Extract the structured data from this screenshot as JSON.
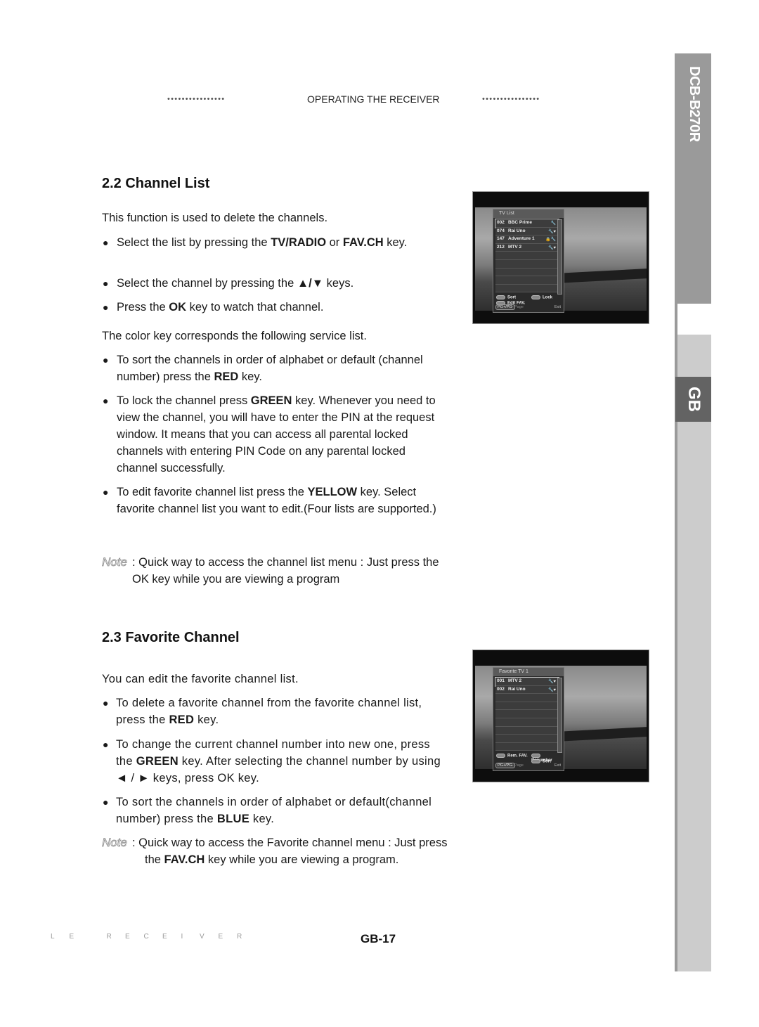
{
  "header": {
    "dots_left": "••••••••••••••••",
    "title": "OPERATING THE RECEIVER",
    "dots_right": "••••••••••••••••"
  },
  "side_tab": {
    "model": "DCB-B270R",
    "language": "GB"
  },
  "section_channel_list": {
    "heading": "2.2 Channel List",
    "intro": "This function is used to delete the channels.",
    "bullets": [
      {
        "pre": "Select the list by pressing the ",
        "b1": "TV/RADIO",
        "mid": " or ",
        "b2": "FAV.CH",
        "post": " key."
      },
      {
        "pre": "Select the channel by pressing the ",
        "arrows": "▲/▼",
        "post": "  keys."
      },
      {
        "pre": "Press the ",
        "b1": "OK",
        "post": " key to watch that channel."
      }
    ],
    "color_key_intro": "The color key corresponds the following service list.",
    "color_bullets": [
      {
        "pre": "To sort the channels in order of alphabet or default (channel number) press the ",
        "b1": "RED",
        "post": " key."
      },
      {
        "pre": "To lock the channel press ",
        "b1": "GREEN",
        "post": " key. Whenever you need to view the channel, you will have to enter the PIN at the request window. It means that you can access all parental locked channels with entering PIN Code on any parental locked channel successfully."
      },
      {
        "pre": "To edit favorite channel list press the ",
        "b1": "YELLOW",
        "post": " key. Select favorite channel list you want to edit.(Four lists are supported.)"
      }
    ],
    "note_label": "Note",
    "note_text": ": Quick way to access the channel list menu : Just press the  OK key while you are viewing a program"
  },
  "section_favorite": {
    "heading": "2.3 Favorite Channel",
    "intro": "You can edit the favorite channel list.",
    "bullets": [
      {
        "pre": "To delete a favorite channel from the favorite channel list, press the ",
        "b1": "RED",
        "post": " key."
      },
      {
        "pre": "To change the current channel number into new one, press the ",
        "b1": "GREEN",
        "mid": " key. After selecting the channel number by using ",
        "arrows": "◄ / ►",
        "post": " keys, press OK key."
      },
      {
        "pre": "To sort the channels in order of alphabet or default(channel number) press the ",
        "b1": "BLUE",
        "post": " key."
      }
    ],
    "note_label": "Note",
    "note_pre": ":  Quick way to access the Favorite channel menu : Just press the ",
    "note_bold": "FAV.CH",
    "note_post": " key while you are viewing a program."
  },
  "screen_tv_list": {
    "title": "TV List",
    "rows": [
      {
        "num": "002",
        "name": "BBC Prime",
        "icons": "🔧"
      },
      {
        "num": "074",
        "name": "Rai Uno",
        "icons": "🔧♥"
      },
      {
        "num": "147",
        "name": "Adventure 1",
        "icons": "🔒🔧"
      },
      {
        "num": "212",
        "name": "MTV 2",
        "icons": "🔧♥"
      },
      {
        "num": "",
        "name": "",
        "icons": ""
      },
      {
        "num": "",
        "name": "",
        "icons": ""
      },
      {
        "num": "",
        "name": "",
        "icons": ""
      },
      {
        "num": "",
        "name": "",
        "icons": ""
      },
      {
        "num": "",
        "name": "",
        "icons": ""
      }
    ],
    "keys": {
      "k1": "Sort",
      "k2": "Lock",
      "k3": "Edit FAV."
    },
    "footer": {
      "page_key": "PG+/PG-",
      "page_label": "Page",
      "exit_label": "Exit"
    }
  },
  "screen_favorite": {
    "title": "Favorite TV 1",
    "rows": [
      {
        "num": "001",
        "name": "MTV 2",
        "icons": "🔧♥"
      },
      {
        "num": "002",
        "name": "Rai Uno",
        "icons": "🔧♥"
      },
      {
        "num": "",
        "name": "",
        "icons": ""
      },
      {
        "num": "",
        "name": "",
        "icons": ""
      },
      {
        "num": "",
        "name": "",
        "icons": ""
      },
      {
        "num": "",
        "name": "",
        "icons": ""
      },
      {
        "num": "",
        "name": "",
        "icons": ""
      },
      {
        "num": "",
        "name": "",
        "icons": ""
      },
      {
        "num": "",
        "name": "",
        "icons": ""
      }
    ],
    "keys": {
      "k1": "Rem. FAV.",
      "k2": "Renumber",
      "k3": "Sort"
    },
    "footer": {
      "page_key": "PG+/PG-",
      "page_label": "Page",
      "exit_label": "Exit"
    }
  },
  "footer": {
    "brand_letters": [
      "L",
      "E",
      "",
      "R",
      "E",
      "C",
      "E",
      "I",
      "V",
      "E",
      "R"
    ],
    "page_number": "GB-17"
  }
}
